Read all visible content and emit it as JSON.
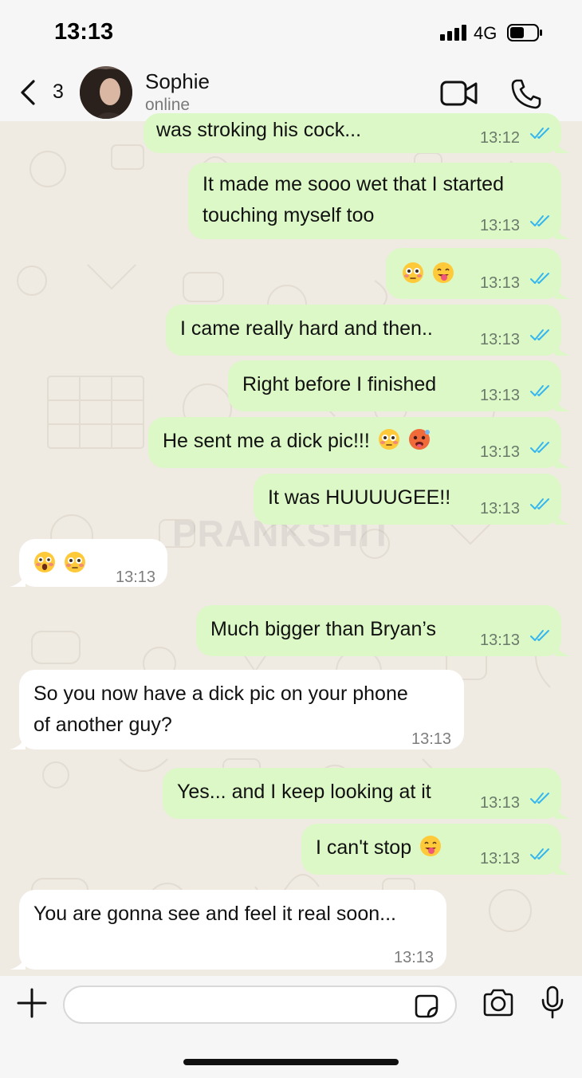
{
  "status_bar": {
    "time": "13:13",
    "network": "4G"
  },
  "header": {
    "back_count": "3",
    "contact_name": "Sophie",
    "contact_status": "online"
  },
  "watermark": "PRANKSHIT",
  "messages": [
    {
      "dir": "out",
      "text": "was stroking his cock...",
      "time": "13:12"
    },
    {
      "dir": "out",
      "lines": [
        "It made me sooo wet that I started",
        "touching myself too"
      ],
      "time": "13:13"
    },
    {
      "dir": "out",
      "emojis": [
        "flushed-face",
        "face-with-tongue"
      ],
      "time": "13:13"
    },
    {
      "dir": "out",
      "text": "I came really hard and then..",
      "time": "13:13"
    },
    {
      "dir": "out",
      "text": "Right before I finished",
      "time": "13:13"
    },
    {
      "dir": "out",
      "text": "He sent me a dick pic!!!",
      "emojis": [
        "flushed-face",
        "hot-face"
      ],
      "time": "13:13"
    },
    {
      "dir": "out",
      "text": "It was HUUUUGEE!!",
      "time": "13:13"
    },
    {
      "dir": "in",
      "emojis": [
        "astonished-face",
        "flushed-face"
      ],
      "time": "13:13"
    },
    {
      "dir": "out",
      "text": "Much bigger than Bryan’s",
      "time": "13:13"
    },
    {
      "dir": "in",
      "lines": [
        "So you now have a dick pic on your phone",
        "of another guy?"
      ],
      "time": "13:13"
    },
    {
      "dir": "out",
      "text": "Yes... and I keep looking at it",
      "time": "13:13"
    },
    {
      "dir": "out",
      "text": "I can't stop",
      "emojis": [
        "face-with-tongue"
      ],
      "time": "13:13"
    },
    {
      "dir": "in",
      "text": "You are gonna see and feel it real soon...",
      "time": "13:13"
    }
  ],
  "input": {
    "placeholder": ""
  },
  "colors": {
    "outgoing_bubble": "#dcf8c6",
    "incoming_bubble": "#ffffff",
    "read_ticks": "#34b7f1",
    "wallpaper": "#efeae2"
  }
}
